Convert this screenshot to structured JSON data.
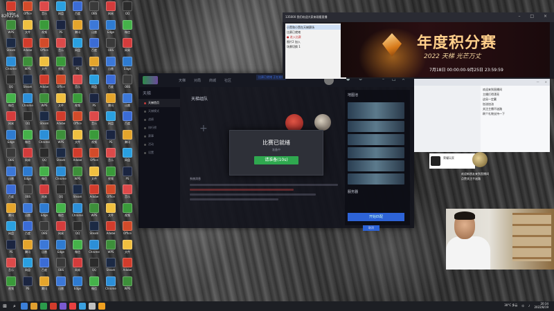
{
  "desktop": {
    "top_label": "8202256",
    "icons": [
      {
        "label": "Adobe",
        "color": "#d23c2c"
      },
      {
        "label": "WPS",
        "color": "#3d8f3a"
      },
      {
        "label": "Steam",
        "color": "#1c2a44"
      },
      {
        "label": "Chrome",
        "color": "#2c8fd8"
      },
      {
        "label": "QQ",
        "color": "#2b2b2b"
      },
      {
        "label": "微信",
        "color": "#45b24a"
      },
      {
        "label": "网易",
        "color": "#d43c3c"
      },
      {
        "label": "Edge",
        "color": "#2e7bd1"
      },
      {
        "label": "OBS",
        "color": "#3a3a3a"
      },
      {
        "label": "迅雷",
        "color": "#3c78d8"
      },
      {
        "label": "百度",
        "color": "#3b6cd6"
      },
      {
        "label": "腾讯",
        "color": "#e4a52c"
      },
      {
        "label": "网盘",
        "color": "#2aa0e0"
      },
      {
        "label": "PS",
        "color": "#1b2540"
      },
      {
        "label": "音乐",
        "color": "#dd4a4a"
      },
      {
        "label": "视频",
        "color": "#3a9a3a"
      },
      {
        "label": "Office",
        "color": "#d24b2a"
      },
      {
        "label": "文件",
        "color": "#f0c040"
      }
    ]
  },
  "game_client": {
    "tabs": [
      "天梯",
      "对局",
      "商城",
      "社区"
    ],
    "notice": "比赛已就绪 正在准备",
    "sidebar_title": "天梯",
    "sidebar_items": [
      "天梯首页",
      "天梯模式",
      "战绩",
      "排行榜",
      "赛事",
      "活动",
      "设置"
    ],
    "main_title": "天梯组队",
    "chat_header": "系统消息",
    "right_title": "地图池",
    "right_sub": "服务器",
    "start_label": "开始匹配",
    "small_btn": "取消"
  },
  "match_modal": {
    "title": "比赛已就绪",
    "subtitle": "准备中",
    "button": "请准备(10s)"
  },
  "obs": {
    "title": "135000 我们欢迎大家来观看直播",
    "tree": [
      {
        "label": "小黑和小黑在天梯赛场",
        "style": "sel"
      },
      {
        "label": "比赛已就绪",
        "style": ""
      },
      {
        "label": "● 进入比赛",
        "style": "red"
      },
      {
        "label": "图片2 加入",
        "style": ""
      },
      {
        "label": "场景切换 1",
        "style": ""
      }
    ]
  },
  "banner": {
    "title": "年度积分赛",
    "subtitle": "2022 天梯 光芒万丈",
    "date": "7月18日 00:00:00-9月25日 23:59:59",
    "accent": "#ffcf8a"
  },
  "chat": {
    "top_actions": [
      "—",
      "×"
    ],
    "messages": [
      "欢迎来到直播间",
      "主播打得漂亮",
      "这局一定赢",
      "加油加油",
      "关注主播不迷路",
      "刷个礼物支持一下"
    ]
  },
  "overlay": {
    "user_name": "荣耀玩家",
    "lines": [
      "欢迎新朋友来到直播间",
      "点赞关注不迷路"
    ]
  },
  "taskbar": {
    "weather": "30°C 多云",
    "time": "20:34",
    "date": "2022/8/19",
    "icons": [
      "#3c7fd8",
      "#e0a030",
      "#2b9b4b",
      "#d23c2c",
      "#7a5ad0",
      "#e84040",
      "#3aa0e0",
      "#c0c0c0",
      "#f0a020"
    ]
  }
}
